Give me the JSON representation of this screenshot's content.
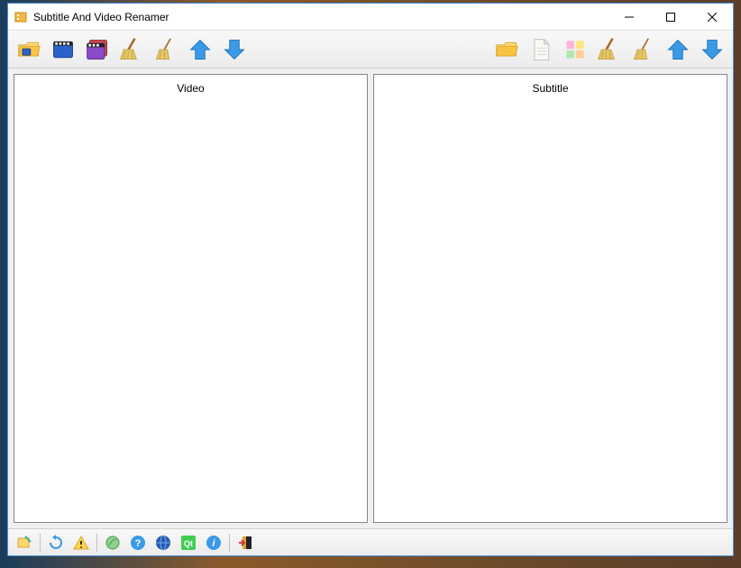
{
  "window": {
    "title": "Subtitle And Video Renamer"
  },
  "toolbar_left": {
    "open_folder": "Open video folder",
    "add_video": "Add video",
    "add_videos": "Add videos",
    "clear_list": "Clear video list",
    "clean": "Clean",
    "move_up": "Move up",
    "move_down": "Move down"
  },
  "toolbar_right": {
    "open_folder": "Open subtitle folder",
    "add_file": "Add subtitle file",
    "add_files": "Add subtitle files",
    "clear_list": "Clear subtitle list",
    "clean": "Clean",
    "move_up": "Move up",
    "move_down": "Move down"
  },
  "panels": {
    "video": {
      "title": "Video"
    },
    "subtitle": {
      "title": "Subtitle"
    }
  },
  "bottombar": {
    "rename": "Rename",
    "refresh": "Refresh",
    "warning": "Warnings",
    "web": "Web",
    "help": "Help",
    "world": "Language",
    "qt": "About Qt",
    "info": "About",
    "exit": "Exit"
  }
}
